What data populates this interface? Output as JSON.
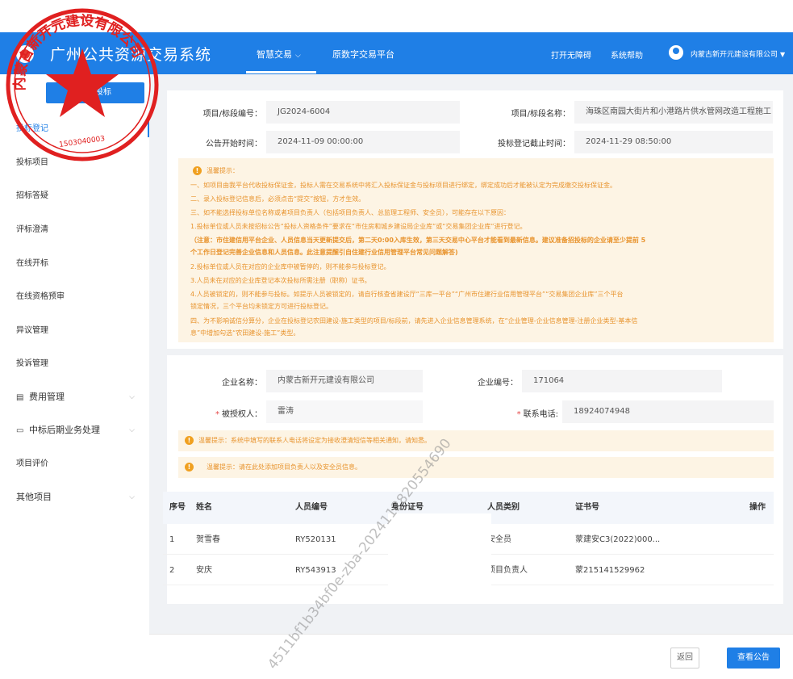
{
  "header": {
    "app_title": "广州公共资源交易系统",
    "nav_main": "智慧交易",
    "nav_second": "原数字交易平台",
    "accessibility": "打开无障碍",
    "help": "系统帮助",
    "company": "内蒙古新开元建设有限公司"
  },
  "sidebar": {
    "my_bid": "我的投标",
    "items": [
      {
        "label": "投标登记"
      },
      {
        "label": "投标项目"
      },
      {
        "label": "招标答疑"
      },
      {
        "label": "评标澄清"
      },
      {
        "label": "在线开标"
      },
      {
        "label": "在线资格预审"
      },
      {
        "label": "异议管理"
      },
      {
        "label": "投诉管理"
      },
      {
        "label": "费用管理"
      },
      {
        "label": "中标后期业务处理"
      },
      {
        "label": "项目评价"
      },
      {
        "label": "其他项目"
      }
    ]
  },
  "project": {
    "code_label": "项目/标段编号：",
    "code_value": "JG2024-6004",
    "name_label": "项目/标段名称：",
    "name_value": "海珠区南园大街片和小港路片供水管网改造工程施工",
    "start_label": "公告开始时间：",
    "start_value": "2024-11-09 00:00:00",
    "deadline_label": "投标登记截止时间：",
    "deadline_value": "2024-11-29 08:50:00"
  },
  "tips": {
    "title": "温馨提示：",
    "lines": [
      "一、如项目由我平台代收投标保证金，投标人需在交易系统中将汇入投标保证金与投标项目进行绑定，绑定成功后才能被认定为完成缴交投标保证金。",
      "二、录入投标登记信息后，必须点击“提交”按钮，方才生效。",
      "三、如不能选择投标单位名称或者项目负责人（包括项目负责人、总监理工程师、安全员），可能存在以下原因：",
      "1.投标单位或人员未按招标公告“投标人资格条件”要求在“市住房和城乡建设局企业库”或“交易集团企业库”进行登记。",
      "（注意：市住建信用平台企业、人员信息当天更新提交后，第二天0:00入库生效，第三天交易中心平台才能看到最新信息。建议准备招投标的企业请至少提前 5",
      "个工作日登记完善企业信息和人员信息。此注意提醒引自住建行业信用管理平台常见问题解答)",
      "2.投标单位或人员在对应的企业库中被暂停的，则不能参与投标登记。",
      "3.人员未在对应的企业库登记本次投标所需注册（职称）证书。",
      "4.人员被锁定的，则不能参与投标。如提示人员被锁定的，请自行核查省建设厅“三库一平台”“广州市住建行业信用管理平台”“交易集团企业库”三个平台",
      "锁定情况，三个平台均未锁定方可进行投标登记。",
      "四、为不影响诚信分算分，企业在投标登记农田建设-施工类型的项目/标段前，请先进入企业信息管理系统，在“企业管理-企业信息管理-注册企业类型-基本信",
      "息”中增加勾选“农田建设-施工”类型。"
    ]
  },
  "company_info": {
    "name_label": "企业名称：",
    "name_value": "内蒙古新开元建设有限公司",
    "code_label": "企业编号：",
    "code_value": "171064",
    "auth_label": "被授权人：",
    "auth_value": "雷涛",
    "phone_label": "联系电话:",
    "phone_value": "18924074948",
    "tip1": "温馨提示：系统中填写的联系人电话将设定为接收澄清短信等相关通知，请知悉。",
    "tip2": "温馨提示：请在此处添加项目负责人以及安全员信息。"
  },
  "table": {
    "headers": [
      "序号",
      "姓名",
      "人员编号",
      "身份证号",
      "人员类别",
      "证书号",
      "操作"
    ],
    "rows": [
      {
        "no": "1",
        "name": "贺雪春",
        "staff_no": "RY520131",
        "category": "安全员",
        "cert": "蒙建安C3(2022)000..."
      },
      {
        "no": "2",
        "name": "安庆",
        "staff_no": "RY543913",
        "category": "项目负责人",
        "cert": "蒙215141529962"
      }
    ]
  },
  "footer": {
    "back": "返回",
    "view_notice": "查看公告"
  },
  "seal": {
    "text_top": "内蒙古新开元建设有限公司",
    "number": "1503040003",
    "color": "#e02020"
  },
  "watermark": {
    "text": "4511bf1b34bf0e-zba-2024112820554690"
  },
  "colors": {
    "primary": "#1f7fe6",
    "notice_bg": "#fdf4e4",
    "notice_text": "#e8932d"
  }
}
